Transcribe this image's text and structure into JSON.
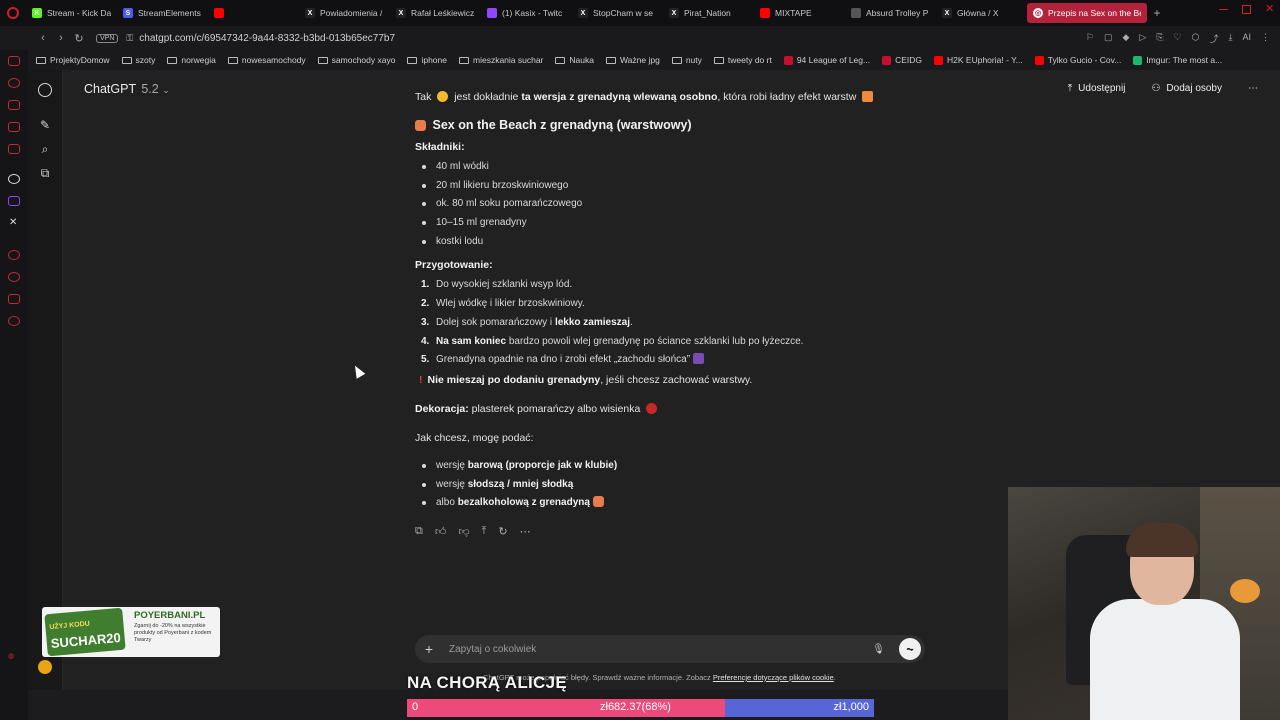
{
  "browser": {
    "tabs": [
      {
        "label": "Stream - Kick Da",
        "icon_color": "#53fc18",
        "icon": "K"
      },
      {
        "label": "StreamElements",
        "icon_color": "#4d5bf0",
        "icon": "S"
      },
      {
        "label": "",
        "icon_color": "#ff0000",
        "icon": ""
      },
      {
        "label": "Powiadomienia /",
        "icon_color": "#222222",
        "icon": "X"
      },
      {
        "label": "Rafał Leśkiewicz",
        "icon_color": "#222222",
        "icon": "X"
      },
      {
        "label": "(1) Kasix - Twitc",
        "icon_color": "#9146ff",
        "icon": ""
      },
      {
        "label": "StopCham w se",
        "icon_color": "#222222",
        "icon": "X"
      },
      {
        "label": "Pirat_Nation",
        "icon_color": "#222222",
        "icon": "X"
      },
      {
        "label": "MIXTAPE",
        "icon_color": "#ff0000",
        "icon": ""
      },
      {
        "label": "Absurd Trolley P",
        "icon_color": "#555555",
        "icon": ""
      },
      {
        "label": "Główna / X",
        "icon_color": "#222222",
        "icon": "X"
      }
    ],
    "active_tab": {
      "label": "Przepis na Sex on the Bea"
    },
    "url": "chatgpt.com/c/69547342-9a44-8332-b3bd-013b65ec77b7",
    "vpn_label": "VPN",
    "ai_label": "AI",
    "bookmarks": [
      {
        "label": "ProjektyDomow",
        "type": "folder"
      },
      {
        "label": "szoty",
        "type": "folder"
      },
      {
        "label": "norwegia",
        "type": "folder"
      },
      {
        "label": "nowesamochody",
        "type": "folder"
      },
      {
        "label": "samochody xayo",
        "type": "folder"
      },
      {
        "label": "iphone",
        "type": "folder"
      },
      {
        "label": "mieszkania suchar",
        "type": "folder"
      },
      {
        "label": "Nauka",
        "type": "folder"
      },
      {
        "label": "Ważne jpg",
        "type": "folder"
      },
      {
        "label": "nuty",
        "type": "folder"
      },
      {
        "label": "tweety do rt",
        "type": "folder"
      },
      {
        "label": "94 League of Leg...",
        "type": "site",
        "color": "#c8102e"
      },
      {
        "label": "CEIDG",
        "type": "site",
        "color": "#c8102e"
      },
      {
        "label": "H2K EUphoria! - Y...",
        "type": "site",
        "color": "#ff0000"
      },
      {
        "label": "Tylko Gucio - Cov...",
        "type": "site",
        "color": "#ff0000"
      },
      {
        "label": "Imgur: The most a...",
        "type": "site",
        "color": "#1bb76e"
      }
    ]
  },
  "chatgpt": {
    "model_name": "ChatGPT",
    "model_version": "5.2",
    "share_label": "Udostępnij",
    "add_people_label": "Dodaj osoby",
    "intro_a": "Tak",
    "intro_b": "jest dokładnie",
    "intro_bold": "ta wersja z grenadyną wlewaną osobno",
    "intro_c": ", która robi ładny efekt warstw",
    "recipe_title": "Sex on the Beach z grenadyną (warstwowy)",
    "ingredients_label": "Składniki:",
    "ingredients": [
      "40 ml wódki",
      "20 ml likieru brzoskwiniowego",
      "ok. 80 ml soku pomarańczowego",
      "10–15 ml grenadyny",
      "kostki lodu"
    ],
    "preparation_label": "Przygotowanie:",
    "steps": [
      {
        "n": "1.",
        "pre": "Do wysokiej szklanki wsyp lód.",
        "bold": "",
        "post": ""
      },
      {
        "n": "2.",
        "pre": "Wlej wódkę i likier brzoskwiniowy.",
        "bold": "",
        "post": ""
      },
      {
        "n": "3.",
        "pre": "Dolej sok pomarańczowy i ",
        "bold": "lekko zamieszaj",
        "post": "."
      },
      {
        "n": "4.",
        "pre": "",
        "bold": "Na sam koniec",
        "post": " bardzo powoli wlej grenadynę po ściance szklanki lub po łyżeczce."
      },
      {
        "n": "5.",
        "pre": "Grenadyna opadnie na dno i zrobi efekt „zachodu słońca”",
        "bold": "",
        "post": ""
      }
    ],
    "warning_bold": "Nie mieszaj po dodaniu grenadyny",
    "warning_rest": ", jeśli chcesz zachować warstwy.",
    "decoration_bold": "Dekoracja:",
    "decoration_rest": " plasterek pomarańczy albo wisienka",
    "offer_intro": "Jak chcesz, mogę podać:",
    "offers": [
      {
        "pre": "wersję ",
        "bold": "barową (proporcje jak w klubie)"
      },
      {
        "pre": "wersję ",
        "bold": "słodszą / mniej słodką"
      },
      {
        "pre": "albo ",
        "bold": "bezalkoholową z grenadyną"
      }
    ],
    "composer_placeholder": "Zapytaj o cokolwiek",
    "disclaimer_text": "ChatGPT może popełniać błędy. Sprawdź ważne informacje. Zobacz",
    "disclaimer_link": "Preferencje dotyczące plików cookie",
    "disclaimer_end": "."
  },
  "stream_overlay": {
    "ad_brand": "POYERBANI.PL",
    "ad_code_small": "UŻYJ KODU",
    "ad_code": "SUCHAR20",
    "ad_text": "Zgarnij do -20% na wszystkie produkty od Poyerbani z kodem Twarzy",
    "caption": "NA CHORĄ ALICJĘ",
    "goal_start": "0",
    "goal_progress_label": "zł682.37(68%)",
    "goal_target": "zł1,000",
    "goal_fraction": 0.68,
    "goal_fill_color": "#ec4a7b",
    "goal_bg_color": "#5865d6"
  }
}
